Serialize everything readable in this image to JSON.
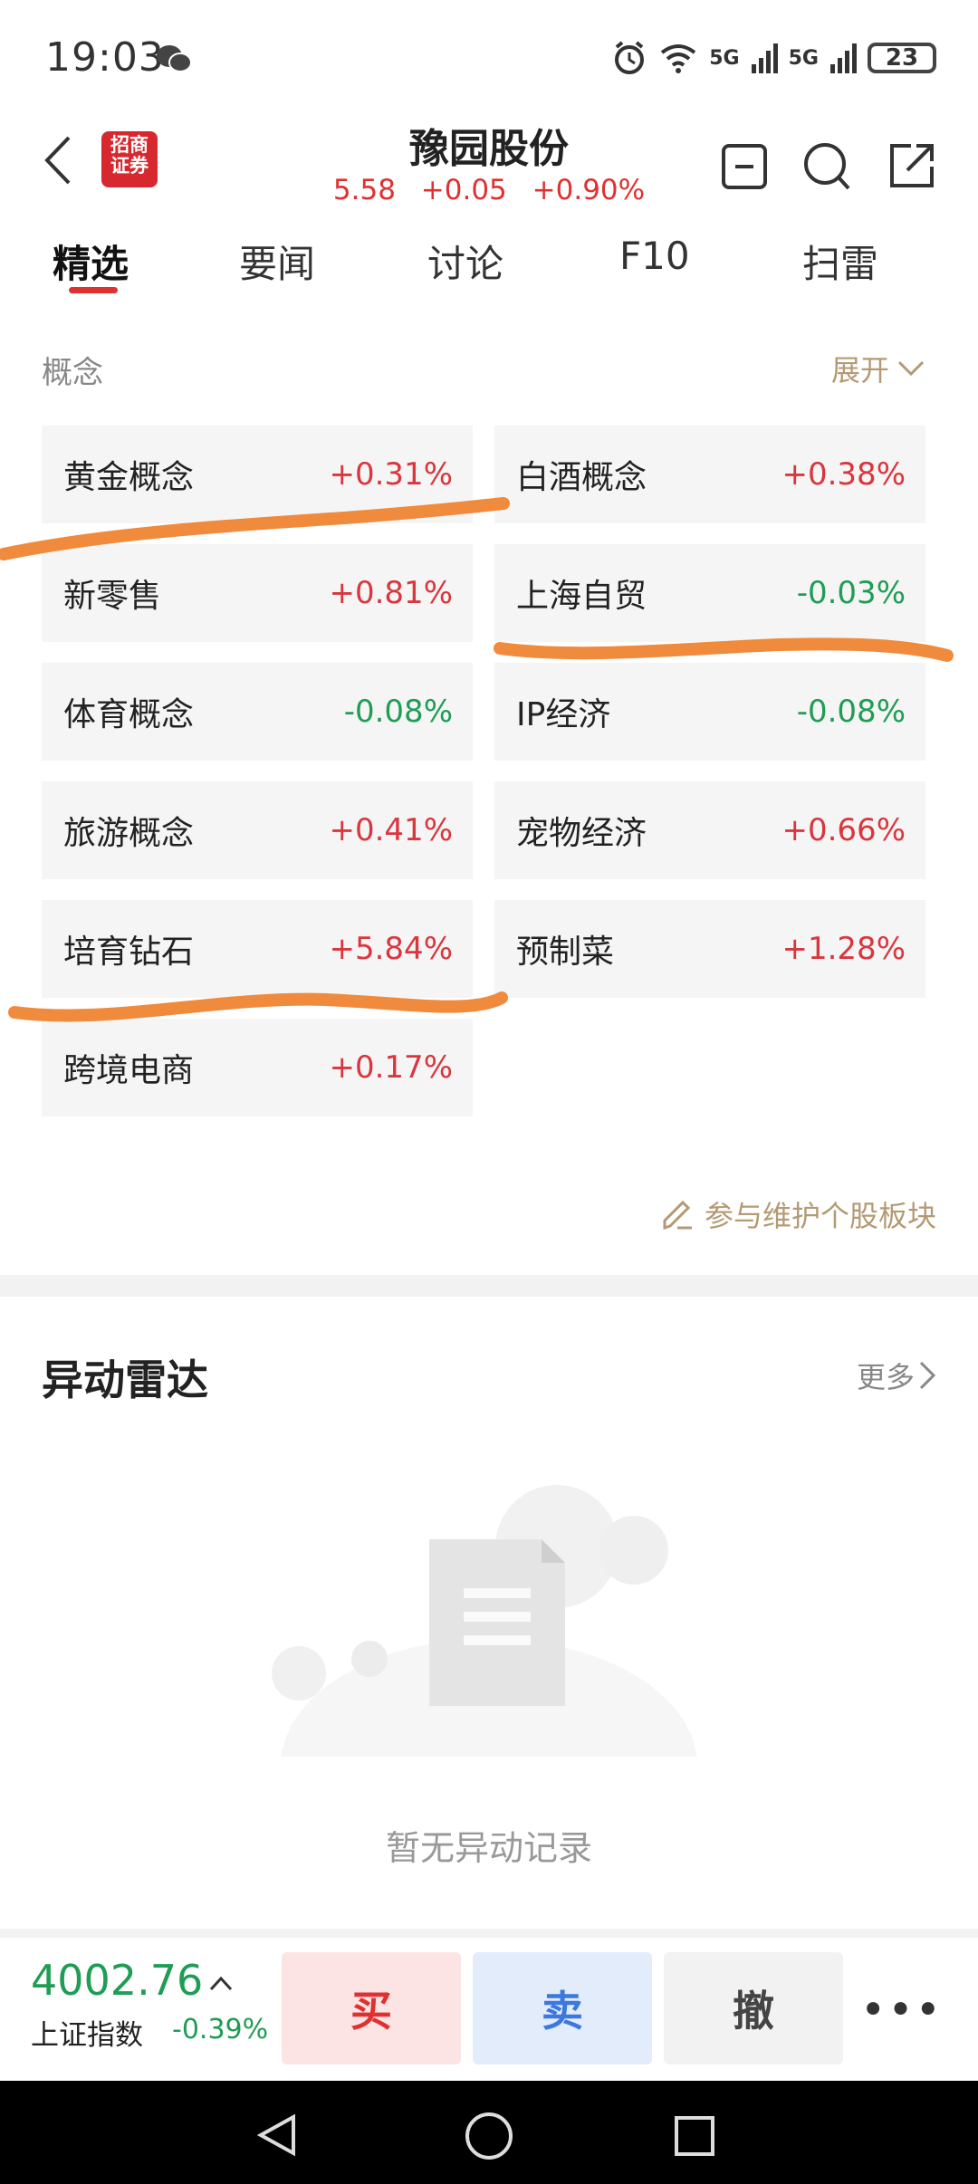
{
  "status": {
    "time": "19:03",
    "battery": "23",
    "net1": "5G",
    "net2": "5G"
  },
  "header": {
    "title": "豫园股份",
    "price": "5.58",
    "change": "+0.05",
    "change_pct": "+0.90%",
    "logo_line1": "招商",
    "logo_line2": "证券"
  },
  "tabs": [
    {
      "label": "精选"
    },
    {
      "label": "要闻"
    },
    {
      "label": "讨论"
    },
    {
      "label": "F10"
    },
    {
      "label": "扫雷"
    }
  ],
  "concepts": {
    "label": "概念",
    "expand_label": "展开",
    "items": [
      {
        "name": "黄金概念",
        "change": "+0.31%"
      },
      {
        "name": "白酒概念",
        "change": "+0.38%"
      },
      {
        "name": "新零售",
        "change": "+0.81%"
      },
      {
        "name": "上海自贸",
        "change": "-0.03%"
      },
      {
        "name": "体育概念",
        "change": "-0.08%"
      },
      {
        "name": "IP经济",
        "change": "-0.08%"
      },
      {
        "name": "旅游概念",
        "change": "+0.41%"
      },
      {
        "name": "宠物经济",
        "change": "+0.66%"
      },
      {
        "name": "培育钻石",
        "change": "+5.84%"
      },
      {
        "name": "预制菜",
        "change": "+1.28%"
      },
      {
        "name": "跨境电商",
        "change": "+0.17%"
      }
    ],
    "maintain_label": "参与维护个股板块"
  },
  "radar": {
    "title": "异动雷达",
    "more_label": "更多",
    "empty_text": "暂无异动记录"
  },
  "trade_bar": {
    "index_value": "4002.76",
    "index_name": "上证指数",
    "index_change": "-0.39%",
    "buy_label": "买",
    "sell_label": "卖",
    "cancel_label": "撤",
    "more_label": "•••"
  },
  "colors": {
    "up": "#d9363e",
    "down": "#1f9d55",
    "accent": "#e03131",
    "highlight": "#f08a3c"
  }
}
